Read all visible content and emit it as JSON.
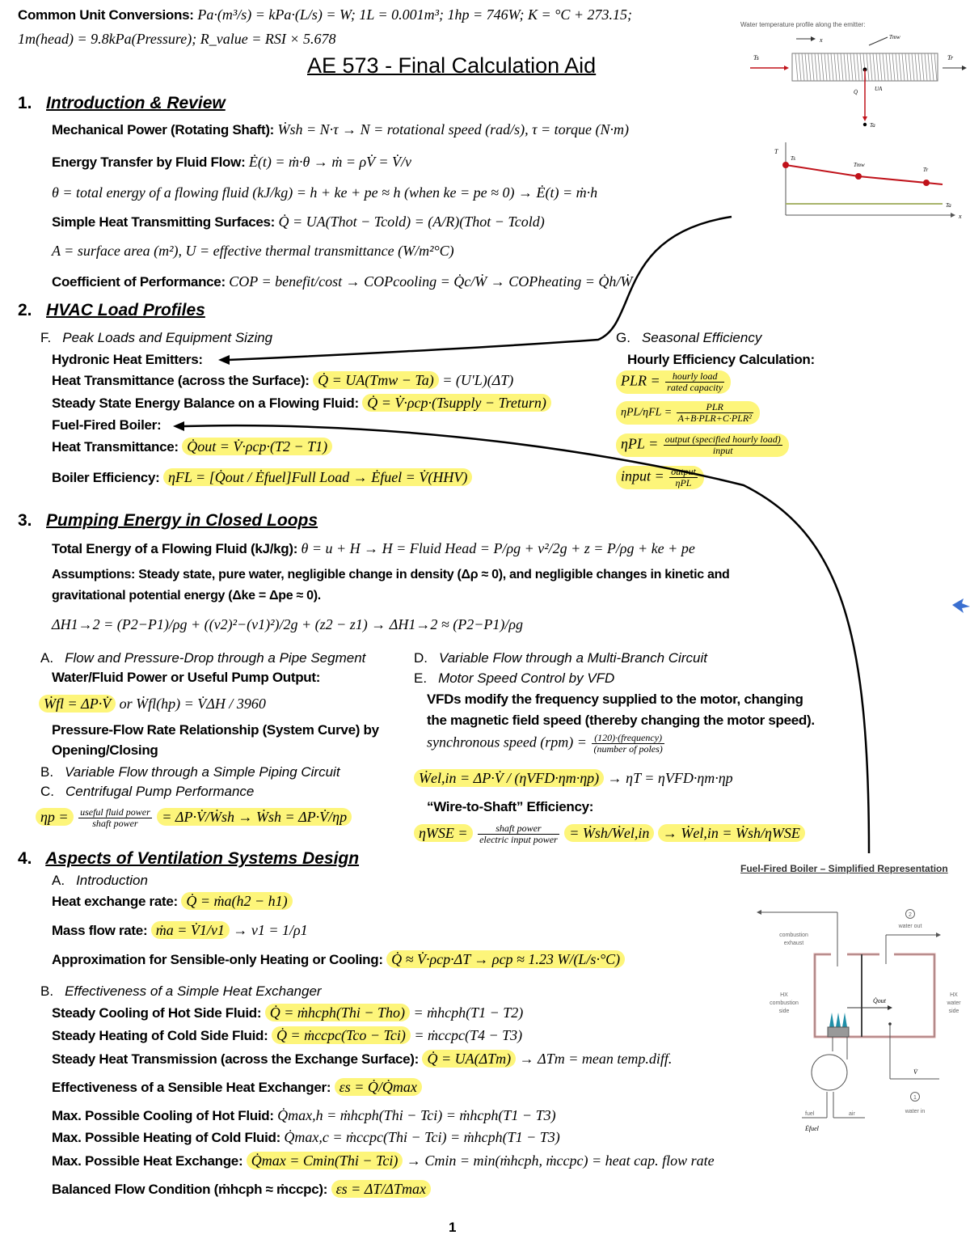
{
  "header": {
    "conversions_label": "Common Unit Conversions:",
    "conversions_line1": "Pa·(m³/s) = kPa·(L/s) = W; 1L = 0.001m³; 1hp = 746W; K = °C + 273.15;",
    "conversions_line2": "1m(head) = 9.8kPa(Pressure); R_value = RSI × 5.678",
    "title": "AE 573 - Final Calculation Aid"
  },
  "section1": {
    "number": "1.",
    "title": "Introduction & Review",
    "rows": [
      {
        "label": "Mechanical Power (Rotating Shaft):",
        "formula": "Ẇsh = N·τ → N = rotational speed (rad/s), τ = torque (N·m)"
      },
      {
        "label": "Energy Transfer by Fluid Flow:",
        "formula": "Ė(t) = ṁ·θ → ṁ = ρV̇ = V̇/v"
      },
      {
        "label": "",
        "formula": "θ = total energy of a flowing fluid (kJ/kg) = h + ke + pe ≈ h (when ke = pe ≈ 0) → Ė(t) = ṁ·h"
      },
      {
        "label": "Simple Heat Transmitting Surfaces:",
        "formula": "Q̇ = UA(Thot − Tcold) = (A/R)(Thot − Tcold)"
      },
      {
        "label": "",
        "formula": "A = surface area (m²), U = effective thermal transmittance (W/m²°C)"
      },
      {
        "label": "Coefficient of Performance:",
        "formula": "COP = benefit/cost → COPcooling = Q̇c/Ẇ → COPheating = Q̇h/Ẇ"
      }
    ]
  },
  "section2": {
    "number": "2.",
    "title": "HVAC Load Profiles",
    "subF": {
      "letter": "F.",
      "title": "Peak Loads and Equipment Sizing",
      "rows": [
        {
          "label": "Hydronic Heat Emitters:",
          "formula": ""
        },
        {
          "label": "Heat Transmittance (across the Surface):",
          "formula": "Q̇ = UA(Tmw − Ta)",
          "rest": "= (U'L)(ΔT)"
        },
        {
          "label": "Steady State Energy Balance on a Flowing Fluid:",
          "formula": "Q̇ = V̇·ρcp·(Tsupply − Treturn)",
          "rest": ""
        },
        {
          "label": "Fuel-Fired Boiler:",
          "formula": ""
        },
        {
          "label": "Heat Transmittance:",
          "formula": "Q̇out = V̇·ρcp·(T2 − T1)",
          "rest": ""
        },
        {
          "label": "Boiler Efficiency:",
          "formula": "ηFL = [Q̇out / Ėfuel]Full Load → Ėfuel = V̇(HHV)",
          "rest": ""
        }
      ]
    },
    "subG": {
      "letter": "G.",
      "title": "Seasonal Efficiency",
      "heading": "Hourly Efficiency Calculation:",
      "formulas": [
        {
          "lhs": "PLR =",
          "num": "hourly load",
          "den": "rated capacity"
        },
        {
          "lhs": "ηPL/ηFL =",
          "num": "PLR",
          "den": "A+B·PLR+C·PLR²"
        },
        {
          "lhs": "ηPL =",
          "num": "output (specified hourly load)",
          "den": "input"
        },
        {
          "lhs": "input =",
          "num": "output",
          "den": "ηPL"
        }
      ]
    }
  },
  "section3": {
    "number": "3.",
    "title": "Pumping Energy in Closed Loops",
    "rows": [
      {
        "label": "Total Energy of a Flowing Fluid (kJ/kg):",
        "formula": "θ = u + H → H = Fluid Head = P/ρg + v²/2g + z = P/ρg + ke + pe"
      },
      {
        "label": "Assumptions: Steady state, pure water, negligible change in density (Δρ ≈ 0), and negligible changes in kinetic and",
        "formula": ""
      },
      {
        "label": "gravitational potential energy (Δke = Δpe ≈ 0).",
        "formula": ""
      },
      {
        "label": "",
        "formula": "ΔH1→2 = (P2−P1)/ρg + ((v2)²−(v1)²)/2g + (z2 − z1) → ΔH1→2 ≈ (P2−P1)/ρg"
      }
    ],
    "left": {
      "A": {
        "letter": "A.",
        "title": "Flow and Pressure-Drop through a Pipe Segment"
      },
      "a_heading": "Water/Fluid Power or Useful Pump Output:",
      "a_formula": "Ẇfl = ΔP·V̇",
      "a_formula_rest": "or Ẇfl(hp) = V̇ΔH / 3960",
      "a_text1": "Pressure-Flow Rate Relationship (System Curve) by",
      "a_text2": "Opening/Closing",
      "B": {
        "letter": "B.",
        "title": "Variable Flow through a Simple Piping Circuit"
      },
      "C": {
        "letter": "C.",
        "title": "Centrifugal Pump Performance"
      },
      "c_formula_lhs": "ηp =",
      "c_formula_num": "useful fluid power",
      "c_formula_den": "shaft power",
      "c_formula_rest": "= ΔP·V̇/Ẇsh → Ẇsh = ΔP·V̇/ηp"
    },
    "right": {
      "D": {
        "letter": "D.",
        "title": "Variable Flow through a Multi-Branch Circuit"
      },
      "E": {
        "letter": "E.",
        "title": "Motor Speed Control by VFD"
      },
      "e_text1": "VFDs modify the frequency supplied to the motor, changing",
      "e_text2": "the magnetic field speed (thereby changing the motor speed).",
      "sync_lhs": "synchronous speed (rpm) =",
      "sync_num": "(120)·(frequency)",
      "sync_den": "(number of poles)",
      "wel_formula": "Ẇel,in = ΔP·V̇ / (ηVFD·ηm·ηp)",
      "wel_rest": "→ ηT = ηVFD·ηm·ηp",
      "wts_heading": "“Wire-to-Shaft” Efficiency:",
      "wts_lhs": "ηWSE =",
      "wts_num": "shaft power",
      "wts_den": "electric input power",
      "wts_mid": "= Ẇsh/Ẇel,in",
      "wts_end": "→ Ẇel,in = Ẇsh/ηWSE"
    }
  },
  "section4": {
    "number": "4.",
    "title": "Aspects of Ventilation Systems Design",
    "A": {
      "letter": "A.",
      "title": "Introduction"
    },
    "a_rows": [
      {
        "label": "Heat exchange rate:",
        "formula": "Q̇ = ṁa(h2 − h1)",
        "rest": ""
      },
      {
        "label": "Mass flow rate:",
        "formula": "ṁa = V̇1/v1",
        "rest": "→ v1 = 1/ρ1"
      },
      {
        "label": "Approximation for Sensible-only Heating or Cooling:",
        "formula": "Q̇ ≈ V̇·ρcp·ΔT → ρcp ≈ 1.23 W/(L/s·°C)",
        "rest": ""
      }
    ],
    "B": {
      "letter": "B.",
      "title": "Effectiveness of a Simple Heat Exchanger"
    },
    "b_rows": [
      {
        "label": "Steady Cooling of Hot Side Fluid:",
        "formula": "Q̇ = ṁhcph(Thi − Tho)",
        "rest": "= ṁhcph(T1 − T2)"
      },
      {
        "label": "Steady Heating of Cold Side Fluid:",
        "formula": "Q̇ = ṁccpc(Tco − Tci)",
        "rest": "= ṁccpc(T4 − T3)"
      },
      {
        "label": "Steady Heat Transmission (across the Exchange Surface):",
        "formula": "Q̇ = UA(ΔTm)",
        "rest": "→ ΔTm = mean temp.diff."
      },
      {
        "label": "Effectiveness of a Sensible Heat Exchanger:",
        "formula": "εs = Q̇/Q̇max",
        "rest": ""
      },
      {
        "label": "Max. Possible Cooling of Hot Fluid:",
        "formula": "",
        "rest": "Q̇max,h = ṁhcph(Thi − Tci) = ṁhcph(T1 − T3)"
      },
      {
        "label": "Max. Possible Heating of Cold Fluid:",
        "formula": "",
        "rest": "Q̇max,c = ṁccpc(Thi − Tci) = ṁhcph(T1 − T3)"
      },
      {
        "label": "Max. Possible Heat Exchange:",
        "formula": "Q̇max = Cmin(Thi − Tci)",
        "rest": "→ Cmin = min(ṁhcph, ṁccpc) = heat cap. flow rate"
      },
      {
        "label": "Balanced Flow Condition (ṁhcph ≈ ṁccpc):",
        "formula": "εs = ΔT/ΔTmax",
        "rest": ""
      }
    ]
  },
  "emitter_figure": {
    "caption": "Water temperature profile along the emitter:",
    "labels": {
      "Ts": "Ts",
      "Tr": "Tr",
      "Tmw": "Tmw",
      "Ta": "Ta",
      "x": "x",
      "Q": "Q̇",
      "UA": "UA",
      "T": "T"
    }
  },
  "boiler_figure": {
    "caption": "Fuel-Fired Boiler – Simplified Representation",
    "labels": {
      "exhaust1": "combustion",
      "exhaust2": "exhaust",
      "water_out": "water out",
      "water_in": "water in",
      "out_num": "2",
      "in_num": "1",
      "hx_comb1": "HX",
      "hx_comb2": "combustion",
      "hx_comb3": "side",
      "hx_water1": "HX",
      "hx_water2": "water",
      "hx_water3": "side",
      "qout": "Q̇out",
      "vdot": "V̇",
      "fuel": "fuel",
      "air": "air",
      "efuel": "Ėfuel"
    }
  },
  "page_number": "1",
  "colors": {
    "highlight": "#fdf57a",
    "red": "#c0121a",
    "green": "#a8b46a",
    "blue": "#3a6fd0",
    "boiler_wall": "#d9a0a0"
  }
}
